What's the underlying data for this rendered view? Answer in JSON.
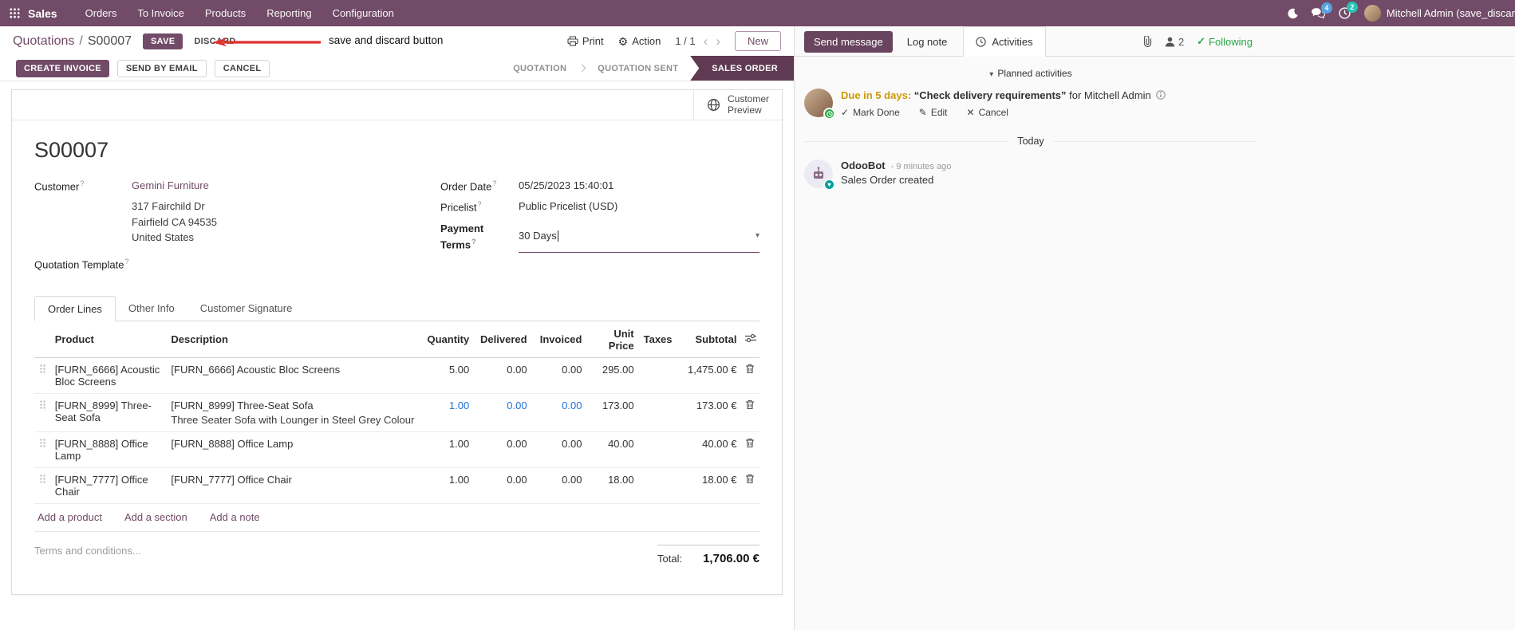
{
  "navbar": {
    "brand": "Sales",
    "menus": [
      "Orders",
      "To Invoice",
      "Products",
      "Reporting",
      "Configuration"
    ],
    "messages_badge": "4",
    "activities_badge": "2",
    "user_name": "Mitchell Admin (save_discar"
  },
  "control": {
    "breadcrumb_parent": "Quotations",
    "breadcrumb_sep": "/",
    "breadcrumb_current": "S00007",
    "save": "SAVE",
    "discard": "DISCARD",
    "annotation": "save and discard button",
    "print": "Print",
    "action": "Action",
    "pager": "1 / 1",
    "prev": "‹",
    "next": "›",
    "new": "New"
  },
  "statusbar": {
    "create_invoice": "CREATE INVOICE",
    "send_by_email": "SEND BY EMAIL",
    "cancel": "CANCEL",
    "states": [
      {
        "label": "QUOTATION"
      },
      {
        "label": "QUOTATION SENT"
      },
      {
        "label": "SALES ORDER"
      }
    ]
  },
  "sheet": {
    "customer_preview_line1": "Customer",
    "customer_preview_line2": "Preview",
    "title": "S00007",
    "help": "?",
    "customer_label": "Customer",
    "customer_name": "Gemini Furniture",
    "address_line1": "317 Fairchild Dr",
    "address_line2": "Fairfield CA 94535",
    "address_line3": "United States",
    "quotation_template_label": "Quotation Template",
    "order_date_label": "Order Date",
    "order_date_value": "05/25/2023 15:40:01",
    "pricelist_label": "Pricelist",
    "pricelist_value": "Public Pricelist (USD)",
    "payment_terms_label": "Payment Terms",
    "payment_terms_value": "30 Days"
  },
  "tabs": [
    {
      "label": "Order Lines"
    },
    {
      "label": "Other Info"
    },
    {
      "label": "Customer Signature"
    }
  ],
  "order_lines": {
    "headers": {
      "product": "Product",
      "description": "Description",
      "quantity": "Quantity",
      "delivered": "Delivered",
      "invoiced": "Invoiced",
      "unit_price": "Unit Price",
      "taxes": "Taxes",
      "subtotal": "Subtotal"
    },
    "rows": [
      {
        "product": "[FURN_6666] Acoustic Bloc Screens",
        "description": "[FURN_6666] Acoustic Bloc Screens",
        "description2": "",
        "quantity": "5.00",
        "delivered": "0.00",
        "invoiced": "0.00",
        "unit_price": "295.00",
        "taxes": "",
        "subtotal": "1,475.00 €"
      },
      {
        "product": "[FURN_8999] Three-Seat Sofa",
        "description": "[FURN_8999] Three-Seat Sofa",
        "description2": "Three Seater Sofa with Lounger in Steel Grey Colour",
        "quantity": "1.00",
        "delivered": "0.00",
        "invoiced": "0.00",
        "unit_price": "173.00",
        "taxes": "",
        "subtotal": "173.00 €"
      },
      {
        "product": "[FURN_8888] Office Lamp",
        "description": "[FURN_8888] Office Lamp",
        "description2": "",
        "quantity": "1.00",
        "delivered": "0.00",
        "invoiced": "0.00",
        "unit_price": "40.00",
        "taxes": "",
        "subtotal": "40.00 €"
      },
      {
        "product": "[FURN_7777] Office Chair",
        "description": "[FURN_7777] Office Chair",
        "description2": "",
        "quantity": "1.00",
        "delivered": "0.00",
        "invoiced": "0.00",
        "unit_price": "18.00",
        "taxes": "",
        "subtotal": "18.00 €"
      }
    ],
    "add_product": "Add a product",
    "add_section": "Add a section",
    "add_note": "Add a note",
    "terms_placeholder": "Terms and conditions...",
    "total_label": "Total:",
    "total_value": "1,706.00 €"
  },
  "chatter": {
    "send_message": "Send message",
    "log_note": "Log note",
    "activities": "Activities",
    "followers_count": "2",
    "following": "Following",
    "check_glyph": "✓",
    "edit_glyph": "✎",
    "cancel_glyph": "✕",
    "caret_glyph": "▾",
    "planned_header": "Planned activities",
    "activity_due": "Due in 5 days:",
    "activity_summary": "“Check delivery requirements”",
    "activity_for": "for Mitchell Admin",
    "mark_done": "Mark Done",
    "edit": "Edit",
    "cancel": "Cancel",
    "date_divider": "Today",
    "msg_author": "OdooBot",
    "msg_time": "- 9 minutes ago",
    "msg_body": "Sales Order created"
  }
}
